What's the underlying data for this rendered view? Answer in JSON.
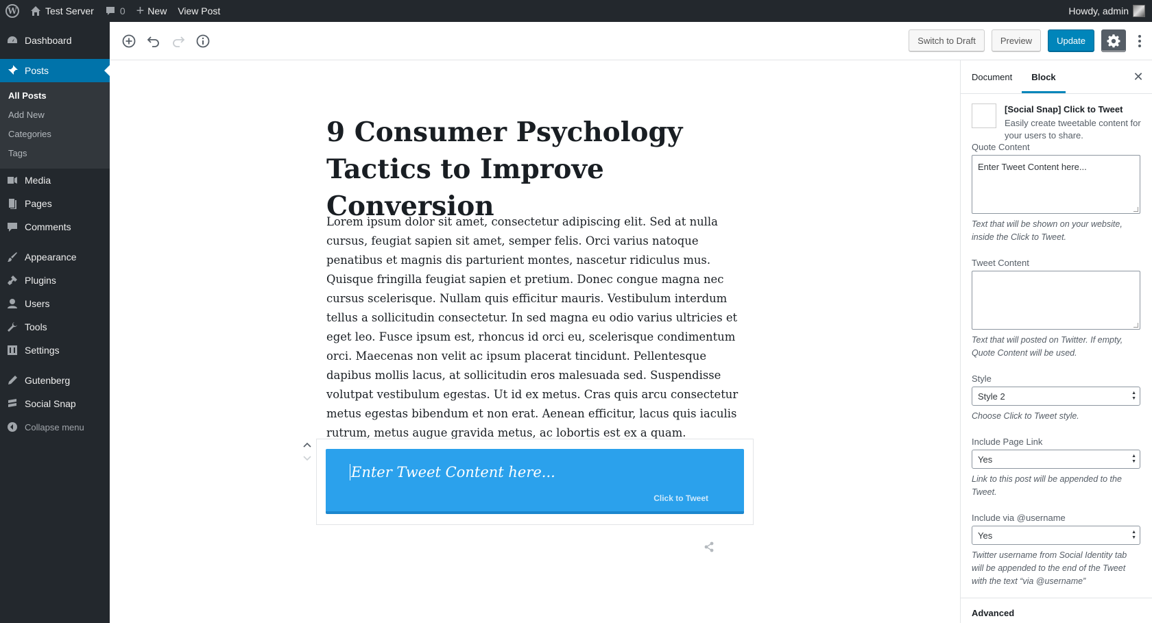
{
  "adminbar": {
    "site_name": "Test Server",
    "comments_count": "0",
    "new_label": "New",
    "view_post_label": "View Post",
    "howdy": "Howdy, admin"
  },
  "sidebar": {
    "dashboard": "Dashboard",
    "posts": "Posts",
    "posts_sub": [
      "All Posts",
      "Add New",
      "Categories",
      "Tags"
    ],
    "media": "Media",
    "pages": "Pages",
    "comments": "Comments",
    "appearance": "Appearance",
    "plugins": "Plugins",
    "users": "Users",
    "tools": "Tools",
    "settings": "Settings",
    "gutenberg": "Gutenberg",
    "social_snap": "Social Snap",
    "collapse": "Collapse menu"
  },
  "toolbar": {
    "switch_to_draft": "Switch to Draft",
    "preview": "Preview",
    "update": "Update"
  },
  "post": {
    "title": "9 Consumer Psychology Tactics to Improve Conversion",
    "body": "Lorem ipsum dolor sit amet, consectetur adipiscing elit. Sed at nulla cursus, feugiat sapien sit amet, semper felis. Orci varius natoque penatibus et magnis dis parturient montes, nascetur ridiculus mus. Quisque fringilla feugiat sapien et pretium. Donec congue magna nec cursus scelerisque. Nullam quis efficitur mauris. Vestibulum interdum tellus a sollicitudin consectetur. In sed magna eu odio varius ultricies et eget leo. Fusce ipsum est, rhoncus id orci eu, scelerisque condimentum orci. Maecenas non velit ac ipsum placerat tincidunt. Pellentesque dapibus mollis lacus, at sollicitudin eros malesuada sed. Suspendisse volutpat vestibulum egestas. Ut id ex metus. Cras quis arcu consectetur metus egestas bibendum et non erat. Aenean efficitur, lacus quis iaculis rutrum, metus augue gravida metus, ac lobortis est ex a quam.",
    "tweet_placeholder": "Enter Tweet Content here...",
    "click_to_tweet": "Click to Tweet"
  },
  "panel": {
    "tab_document": "Document",
    "tab_block": "Block",
    "close": "✕",
    "block_title": "[Social Snap] Click to Tweet",
    "block_desc": "Easily create tweetable content for your users to share.",
    "quote_label": "Quote Content",
    "quote_value": "Enter Tweet Content here...",
    "quote_help": "Text that will be shown on your website, inside the Click to Tweet.",
    "tweet_label": "Tweet Content",
    "tweet_value": "",
    "tweet_help": "Text that will posted on Twitter. If empty, Quote Content will be used.",
    "style_label": "Style",
    "style_value": "Style 2",
    "style_help": "Choose Click to Tweet style.",
    "page_link_label": "Include Page Link",
    "page_link_value": "Yes",
    "page_link_help": "Link to this post will be appended to the Tweet.",
    "via_label": "Include via @username",
    "via_value": "Yes",
    "via_help": "Twitter username from Social Identity tab will be appended to the end of the Tweet with the text “via @username”",
    "advanced_label": "Advanced"
  },
  "colors": {
    "admin_dark": "#23282d",
    "accent": "#0073aa",
    "primary_button": "#0085ba",
    "tweet_box": "#2ba1ec"
  }
}
